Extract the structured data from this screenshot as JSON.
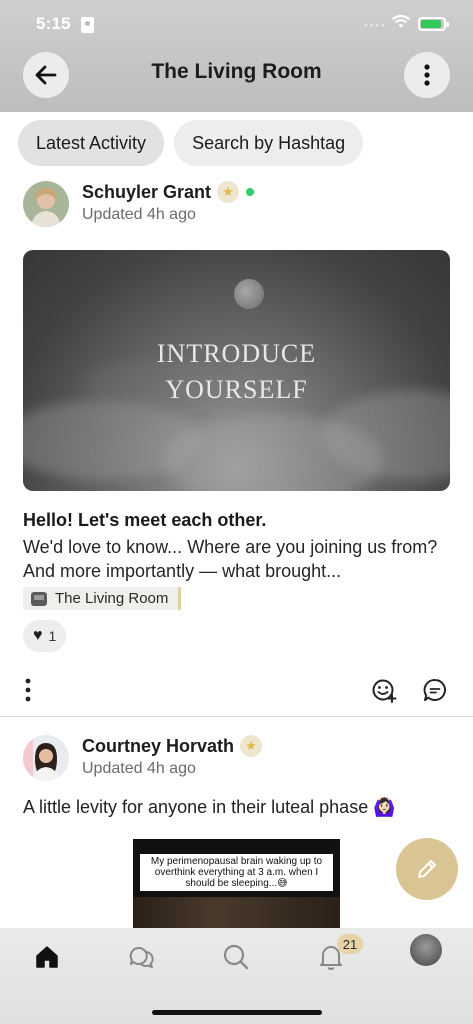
{
  "status_bar": {
    "time": "5:15"
  },
  "header": {
    "title": "The Living Room"
  },
  "tabs": [
    {
      "label": "Latest Activity",
      "active": true
    },
    {
      "label": "Search by Hashtag",
      "active": false
    }
  ],
  "posts": [
    {
      "author": "Schuyler Grant",
      "updated": "Updated 4h ago",
      "online": true,
      "hero_text_line1": "INTRODUCE",
      "hero_text_line2": "YOURSELF",
      "title": "Hello! Let's meet each other.",
      "body": "We'd love to know... Where are you joining us from? And more importantly — what brought...",
      "tag": "The Living Room",
      "reaction_count": "1"
    },
    {
      "author": "Courtney Horvath",
      "updated": "Updated 4h ago",
      "text": "A little levity for anyone in their luteal phase 🙆🏻‍♀️",
      "meme_caption": "My perimenopausal brain waking up to overthink everything at 3 a.m. when I should be sleeping...😅"
    }
  ],
  "bottom_nav": {
    "notification_count": "21",
    "items": [
      "home-icon",
      "chat-icon",
      "search-icon",
      "bell-icon",
      "profile-avatar"
    ]
  },
  "colors": {
    "accent": "#d9c494",
    "online": "#2ecc71",
    "badge": "#e6d3a6"
  }
}
